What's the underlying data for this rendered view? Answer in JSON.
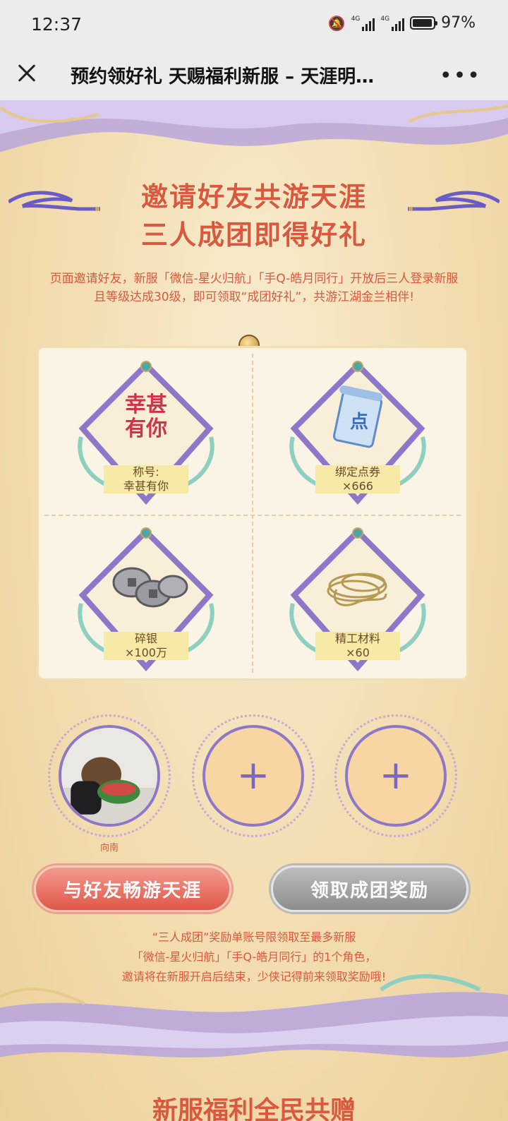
{
  "status_bar": {
    "time": "12:37",
    "network_1": "4G",
    "network_2": "4G",
    "battery": "97%",
    "battery_level": 0.97
  },
  "nav": {
    "title": "预约领好礼 天赐福利新服 – 天涯明…",
    "more": "•••"
  },
  "section": {
    "heading_line1": "邀请好友共游天涯",
    "heading_line2": "三人成团即得好礼",
    "intro_line1": "页面邀请好友，新服「微信-星火归航」「手Q-皓月同行」开放后三人登录新服",
    "intro_line2": "且等级达成30级，即可领取“成团好礼”，共游江湖金兰相伴!"
  },
  "rewards": [
    {
      "name_line1": "称号:",
      "name_line2": "幸甚有你",
      "icon": "title-calligraphy-icon",
      "calligraphy": "幸甚有你"
    },
    {
      "name_line1": "绑定点券",
      "name_line2": "×666",
      "icon": "scroll-coupon-icon",
      "glyph": "点"
    },
    {
      "name_line1": "碎银",
      "name_line2": "×100万",
      "icon": "silver-coins-icon"
    },
    {
      "name_line1": "精工材料",
      "name_line2": "×60",
      "icon": "golden-thread-icon"
    }
  ],
  "team": {
    "member_name": "向南",
    "plus": "+"
  },
  "buttons": {
    "invite": "与好友畅游天涯",
    "claim": "领取成团奖励"
  },
  "footer": {
    "line1": "“三人成团”奖励单账号限领取至最多新服",
    "line2": "「微信-星火归航」「手Q-皓月同行」的1个角色，",
    "line3": "邀请将在新服开启后结束，少侠记得前来领取奖励哦!"
  },
  "bottom_title": "新服福利全民共赠",
  "colors": {
    "accent_red": "#d9583e",
    "purple": "#8e77c9",
    "background": "#f3ddb0"
  }
}
